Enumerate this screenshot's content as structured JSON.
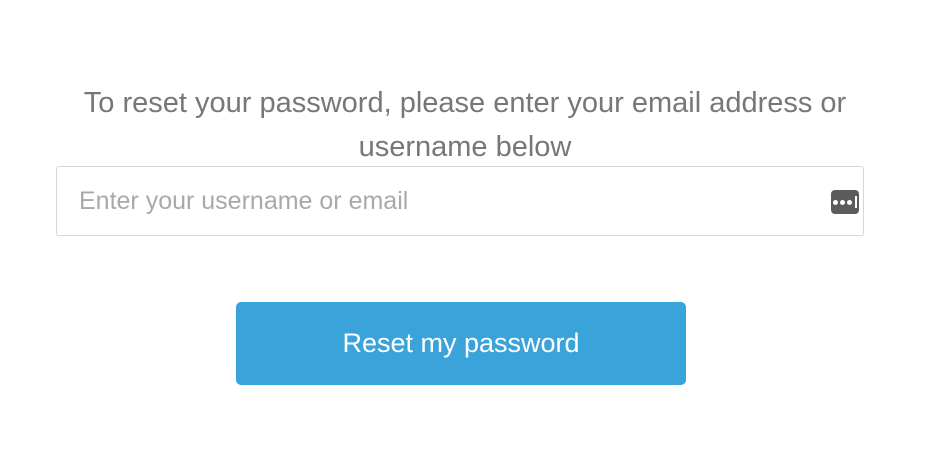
{
  "instructions": {
    "text": "To reset your password, please enter your email address or username below"
  },
  "username_field": {
    "value": "",
    "placeholder": "Enter your username or email",
    "icon": "password-manager-icon"
  },
  "reset_button": {
    "label": "Reset my password",
    "color": "#3aa3d9"
  },
  "colors": {
    "text": "#777777",
    "placeholder": "#a9a9a9",
    "border": "#d6d6d6",
    "button": "#3aa3d9",
    "button_text": "#ffffff"
  }
}
